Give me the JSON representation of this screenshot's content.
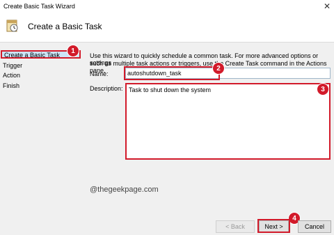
{
  "window": {
    "title": "Create Basic Task Wizard",
    "close_glyph": "✕"
  },
  "banner": {
    "title": "Create a Basic Task",
    "icon": "task-scheduler-icon"
  },
  "sidebar": {
    "items": [
      {
        "label": "Create a Basic Task",
        "active": true
      },
      {
        "label": "Trigger"
      },
      {
        "label": "Action"
      },
      {
        "label": "Finish"
      }
    ]
  },
  "content": {
    "intro_line1": "Use this wizard to quickly schedule a common task.  For more advanced options or settings",
    "intro_line2": "such as multiple task actions or triggers, use the Create Task command in the Actions pane.",
    "name_label": "Name:",
    "name_value": "autoshutdown_task",
    "description_label": "Description:",
    "description_value": "Task to shut down the system",
    "watermark": "@thegeekpage.com"
  },
  "badges": [
    "1",
    "2",
    "3",
    "4"
  ],
  "buttons": {
    "back": "< Back",
    "next": "Next >",
    "cancel": "Cancel"
  },
  "colors": {
    "highlight": "#d21a2a",
    "selection": "#cce4f7"
  }
}
